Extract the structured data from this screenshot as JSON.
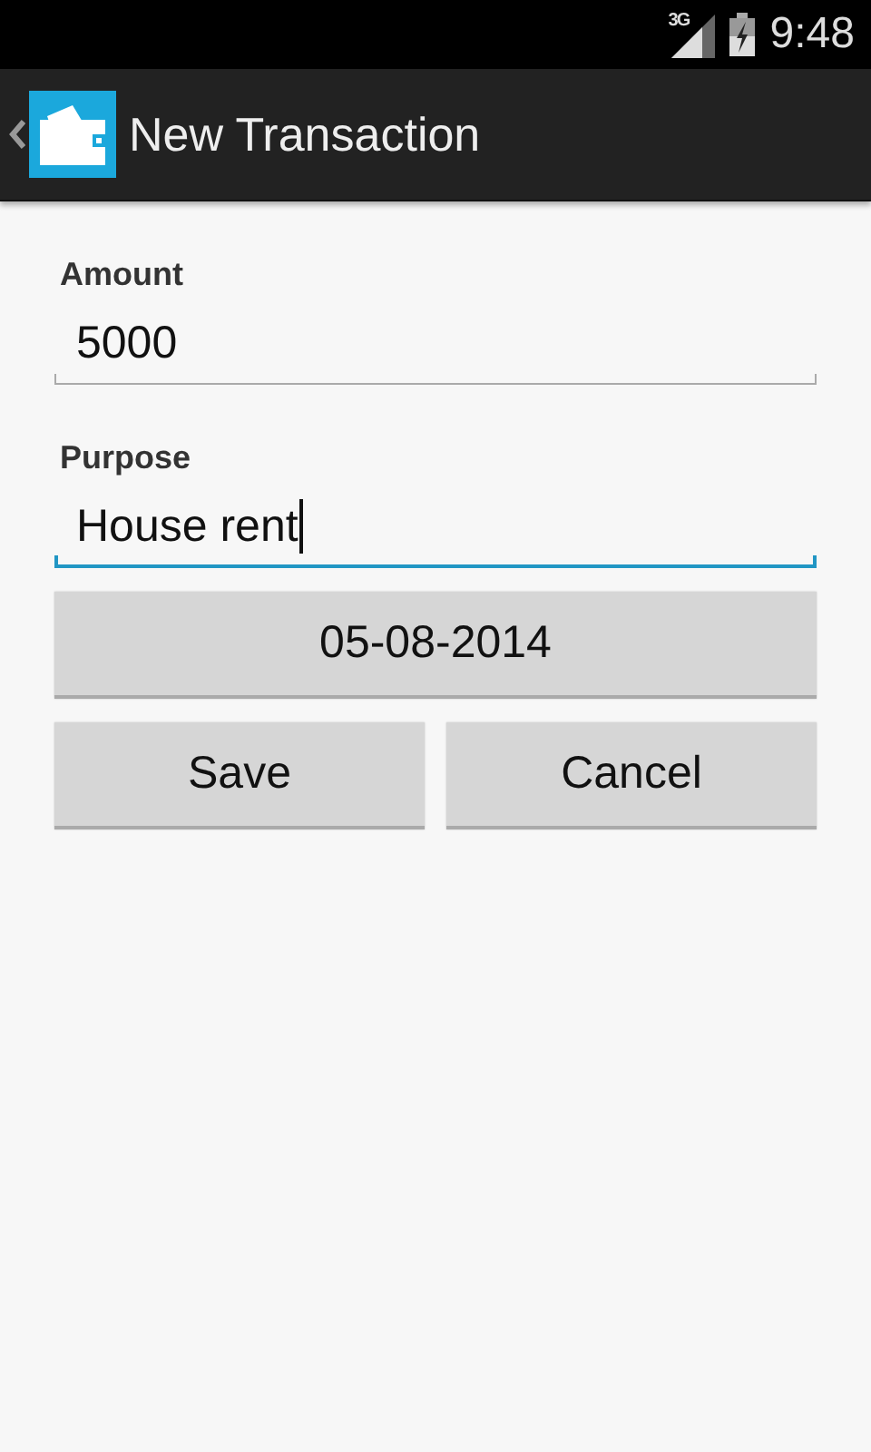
{
  "status_bar": {
    "network": "3G",
    "time": "9:48"
  },
  "action_bar": {
    "title": "New Transaction"
  },
  "fields": [
    {
      "label": "Amount",
      "value": "5000",
      "focused": false
    },
    {
      "label": "Purpose",
      "value": "House rent",
      "focused": true
    }
  ],
  "date_button": "05-08-2014",
  "buttons": [
    "Save",
    "Cancel"
  ]
}
